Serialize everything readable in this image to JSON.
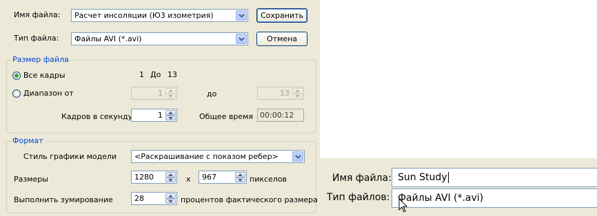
{
  "file": {
    "name_label": "Имя файла:",
    "name_value": "Расчет инсоляции (Ю3 изометрия)",
    "type_label": "Тип файла:",
    "type_value": "Файлы AVI (*.avi)"
  },
  "buttons": {
    "save": "Сохранить",
    "cancel": "Отмена"
  },
  "size_group": {
    "title": "Размер файла",
    "all_frames": "Все кадры",
    "range_from": "Диапазон от",
    "frames_start": "1",
    "frames_to": "До",
    "frames_end": "13",
    "to_label": "до",
    "range_from_value": "1",
    "range_to_value": "13",
    "fps_label": "Кадров в секунду",
    "fps_value": "1",
    "total_time_label": "Общее время",
    "total_time_value": "00:00:12",
    "selected": "all_frames"
  },
  "format_group": {
    "title": "Формат",
    "style_label": "Стиль графики модели",
    "style_value": "<Раскрашивание с показом ребер>",
    "dims_label": "Размеры",
    "width_value": "1280",
    "x_label": "x",
    "height_value": "967",
    "pixels_label": "пикселов",
    "zoom_label": "Выполнить зумирование",
    "zoom_value": "28",
    "zoom_suffix": "процентов фактического размера"
  },
  "zoomed": {
    "name_label": "Имя файла:",
    "name_value": "Sun Study",
    "type_label": "Тип файлов:",
    "type_value": "Файлы AVI  (*.avi)"
  },
  "icons": {
    "dropdown": "chevron-down-icon",
    "spin_up": "spin-up-icon",
    "spin_down": "spin-down-icon",
    "cursor": "mouse-cursor-icon"
  }
}
